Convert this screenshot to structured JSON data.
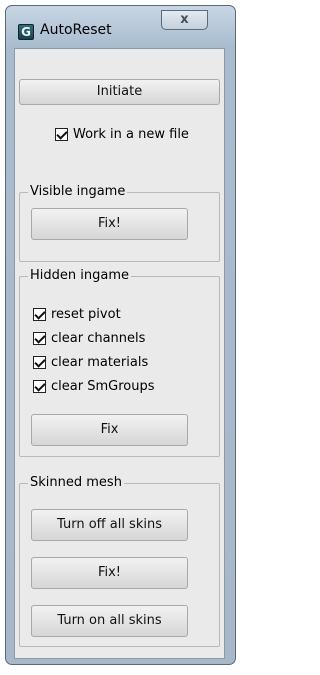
{
  "window": {
    "title": "AutoReset",
    "close_symbol": "x",
    "app_icon": "app-icon",
    "app_icon_glyph": "G"
  },
  "main": {
    "initiate_label": "Initiate",
    "work_in_new_file": {
      "label": "Work in a new file",
      "checked": true
    }
  },
  "visible_ingame": {
    "title": "Visible ingame",
    "fix_label": "Fix!"
  },
  "hidden_ingame": {
    "title": "Hidden ingame",
    "options": [
      {
        "label": "reset pivot",
        "checked": true
      },
      {
        "label": "clear channels",
        "checked": true
      },
      {
        "label": "clear materials",
        "checked": true
      },
      {
        "label": "clear SmGroups",
        "checked": true
      }
    ],
    "fix_label": "Fix"
  },
  "skinned_mesh": {
    "title": "Skinned mesh",
    "turn_off_label": "Turn off all skins",
    "fix_label": "Fix!",
    "turn_on_label": "Turn on all skins"
  }
}
